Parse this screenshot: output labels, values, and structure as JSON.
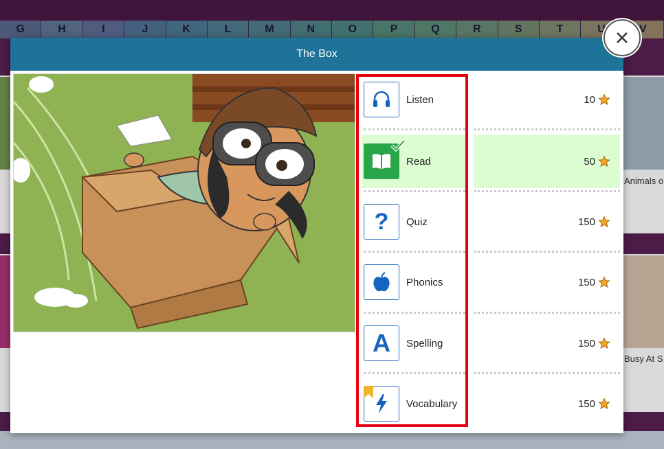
{
  "alphabet": [
    "G",
    "H",
    "I",
    "J",
    "K",
    "L",
    "M",
    "N",
    "O",
    "P",
    "Q",
    "R",
    "S",
    "T",
    "U",
    "V"
  ],
  "background": {
    "right_labels": [
      "Animals o",
      "Busy At S"
    ]
  },
  "modal": {
    "title": "The Box",
    "close_icon": "close-icon",
    "activities": [
      {
        "label": "Listen",
        "icon": "headphones-icon",
        "points": "10",
        "completed": false
      },
      {
        "label": "Read",
        "icon": "book-icon",
        "points": "50",
        "completed": true
      },
      {
        "label": "Quiz",
        "icon": "question-icon",
        "points": "150",
        "completed": false
      },
      {
        "label": "Phonics",
        "icon": "apple-icon",
        "points": "150",
        "completed": false
      },
      {
        "label": "Spelling",
        "icon": "letter-a-icon",
        "points": "150",
        "completed": false
      },
      {
        "label": "Vocabulary",
        "icon": "lightning-icon",
        "points": "150",
        "completed": false
      }
    ]
  },
  "colors": {
    "header": "#1f7398",
    "highlight_border": "#e8000d",
    "completed_bg": "#dcfdd2",
    "icon_blue": "#1565c0",
    "star": "#f5a623"
  }
}
